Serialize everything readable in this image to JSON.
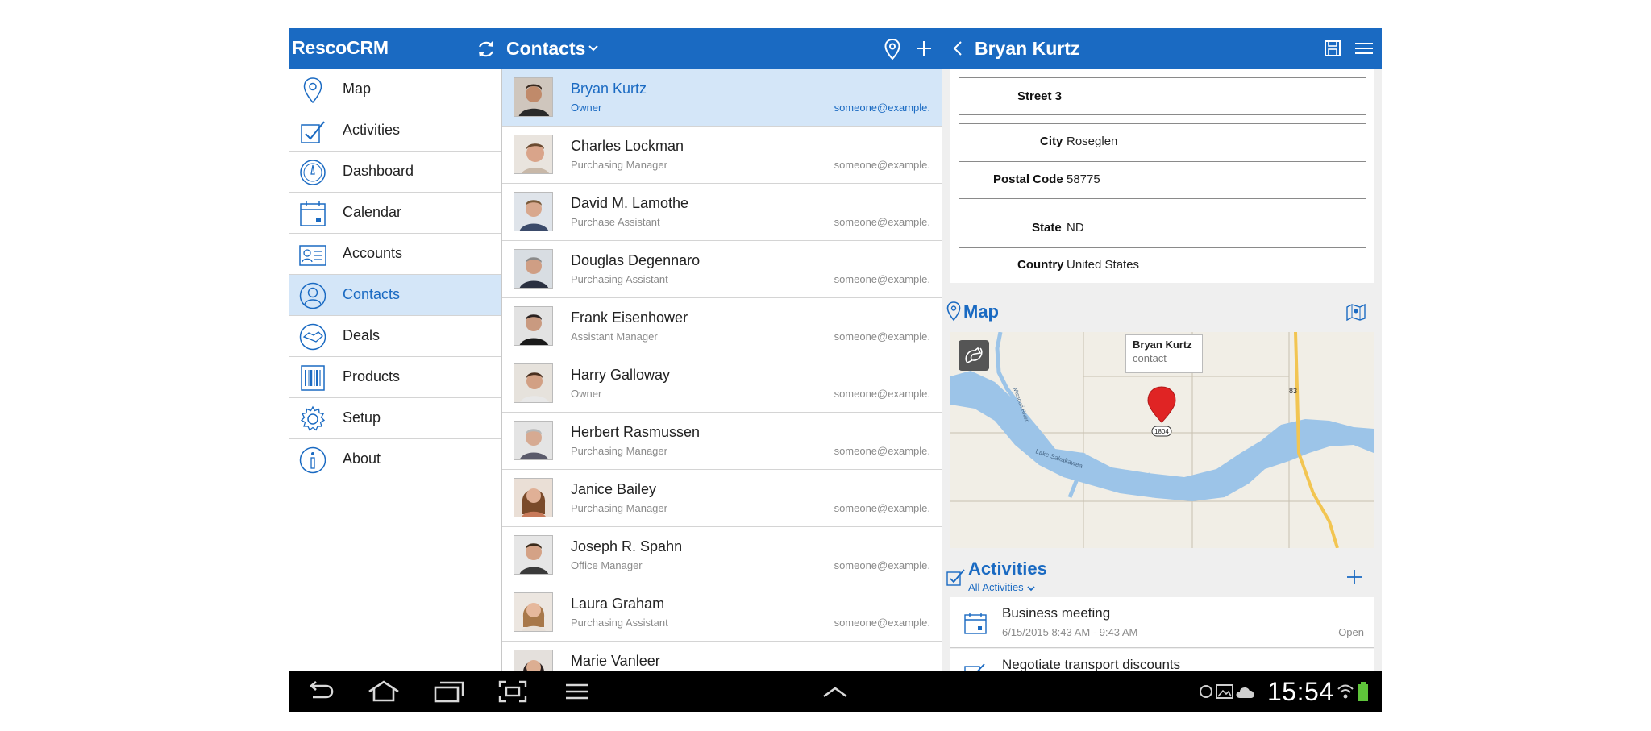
{
  "header": {
    "app_title": "RescoCRM",
    "list_title": "Contacts",
    "detail_title": "Bryan Kurtz"
  },
  "colors": {
    "primary": "#1a6ac2",
    "selected_row": "#d4e6f8",
    "map_marker": "#e02424",
    "system_bar": "#000000"
  },
  "sidebar": {
    "items": [
      {
        "label": "Map",
        "icon": "map-pin-icon"
      },
      {
        "label": "Activities",
        "icon": "activities-check-icon"
      },
      {
        "label": "Dashboard",
        "icon": "dashboard-gauge-icon"
      },
      {
        "label": "Calendar",
        "icon": "calendar-icon"
      },
      {
        "label": "Accounts",
        "icon": "accounts-card-icon"
      },
      {
        "label": "Contacts",
        "icon": "contacts-person-icon",
        "selected": true
      },
      {
        "label": "Deals",
        "icon": "deals-handshake-icon"
      },
      {
        "label": "Products",
        "icon": "products-barcode-icon"
      },
      {
        "label": "Setup",
        "icon": "gear-icon"
      },
      {
        "label": "About",
        "icon": "info-icon"
      }
    ]
  },
  "contacts": [
    {
      "name": "Bryan Kurtz",
      "role": "Owner",
      "email": "someone@example.",
      "selected": true
    },
    {
      "name": "Charles Lockman",
      "role": "Purchasing Manager",
      "email": "someone@example."
    },
    {
      "name": "David M. Lamothe",
      "role": "Purchase Assistant",
      "email": "someone@example."
    },
    {
      "name": "Douglas Degennaro",
      "role": "Purchasing Assistant",
      "email": "someone@example."
    },
    {
      "name": "Frank Eisenhower",
      "role": "Assistant Manager",
      "email": "someone@example."
    },
    {
      "name": "Harry Galloway",
      "role": "Owner",
      "email": "someone@example."
    },
    {
      "name": "Herbert Rasmussen",
      "role": "Purchasing Manager",
      "email": "someone@example."
    },
    {
      "name": "Janice Bailey",
      "role": "Purchasing Manager",
      "email": "someone@example."
    },
    {
      "name": "Joseph R. Spahn",
      "role": "Office Manager",
      "email": "someone@example."
    },
    {
      "name": "Laura Graham",
      "role": "Purchasing Assistant",
      "email": "someone@example."
    },
    {
      "name": "Marie Vanleer",
      "role": "",
      "email": ""
    }
  ],
  "detail": {
    "address": {
      "street3_label": "Street 3",
      "street3_value": "",
      "city_label": "City",
      "city_value": "Roseglen",
      "postal_label": "Postal Code",
      "postal_value": "58775",
      "state_label": "State",
      "state_value": "ND",
      "country_label": "Country",
      "country_value": "United States"
    },
    "map": {
      "title": "Map",
      "tooltip_name": "Bryan Kurtz",
      "tooltip_type": "contact",
      "labels": {
        "road_1804": "1804",
        "road_83": "83",
        "lake": "Lake Sakakawea",
        "river": "Missouri River"
      }
    },
    "activities": {
      "title": "Activities",
      "filter": "All Activities",
      "items": [
        {
          "name": "Business meeting",
          "time": "6/15/2015 8:43 AM - 9:43 AM",
          "status": "Open"
        },
        {
          "name": "Negotiate transport discounts",
          "time": "",
          "status": ""
        }
      ]
    }
  },
  "system_bar": {
    "clock": "15:54"
  }
}
